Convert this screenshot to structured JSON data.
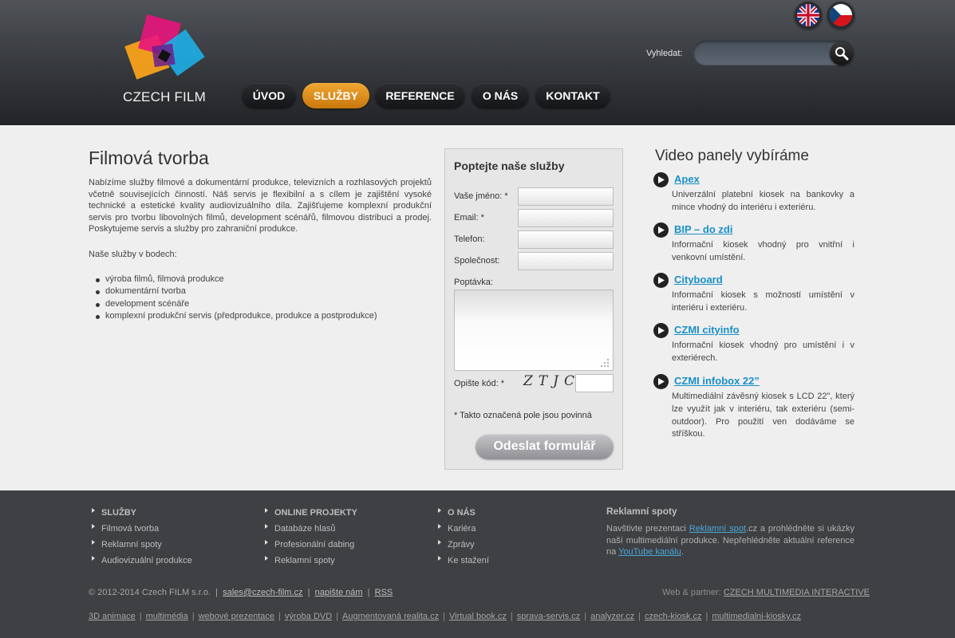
{
  "header": {
    "logo_text": "CZECH FILM",
    "search_label": "Vyhledat:",
    "search_placeholder": "",
    "languages": [
      "en-flag-icon",
      "cz-flag-icon"
    ],
    "nav": [
      {
        "label": "ÚVOD",
        "active": false
      },
      {
        "label": "SLUŽBY",
        "active": true
      },
      {
        "label": "REFERENCE",
        "active": false
      },
      {
        "label": "O NÁS",
        "active": false
      },
      {
        "label": "KONTAKT",
        "active": false
      }
    ]
  },
  "main": {
    "title": "Filmová tvorba",
    "intro": "Nabízíme služby filmové a dokumentární produkce, televizních a rozhlasových projektů včetně souvisejících činností. Náš servis je flexibilní a s cílem je zajištění vysoké technické a estetické kvality audiovizuálního díla. Zajišťujeme komplexní produkční servis pro tvorbu libovolných filmů, development scénářů, filmovou distribuci a prodej. Poskytujeme servis a služby pro zahraniční produkce.",
    "points_title": "Naše služby v bodech:",
    "points": [
      "výroba filmů, filmová produkce",
      "dokumentární tvorba",
      "development scénáře",
      "komplexní produkční servis (předprodukce, produkce a postprodukce)"
    ]
  },
  "form": {
    "title": "Poptejte naše služby",
    "name_label": "Vaše jméno: *",
    "email_label": "Email: *",
    "phone_label": "Telefon:",
    "company_label": "Společnost:",
    "inquiry_label": "Poptávka:",
    "captcha_label": "Opište kód: *",
    "captcha_code": "ZTJC",
    "required_note": "* Takto označená pole jsou povinná",
    "submit_label": "Odeslat formulář"
  },
  "panels": {
    "title": "Video panely vybíráme",
    "items": [
      {
        "name": "Apex",
        "desc": "Univerzální platební kiosek na bankovky a mince vhodný do interiéru i exteriéru."
      },
      {
        "name": "BIP – do zdi",
        "desc": "Informační kiosek vhodný pro vnitřní i venkovní umístění."
      },
      {
        "name": "Cityboard",
        "desc": "Informační kiosek s možností umístění v interiéru i exteriéru."
      },
      {
        "name": "CZMI cityinfo",
        "desc": "Informační kiosek vhodný pro umístění i v exteriérech."
      },
      {
        "name": "CZMI infobox 22”",
        "desc": "Multimediální závěsný kiosek s LCD 22\", který lze využít jak v interiéru, tak exteriéru (semi-outdoor). Pro použití ven dodáváme se stříškou."
      }
    ]
  },
  "footer": {
    "columns": [
      {
        "title": "SLUŽBY",
        "items": [
          "Filmová tvorba",
          "Reklamní spoty",
          "Audiovizuální produkce"
        ]
      },
      {
        "title": "ONLINE PROJEKTY",
        "items": [
          "Databáze hlasů",
          "Profesionální dabing",
          "Reklamní spoty"
        ]
      },
      {
        "title": "O NÁS",
        "items": [
          "Kariéra",
          "Zprávy",
          "Ke stažení"
        ]
      }
    ],
    "rs_title": "Reklamní spoty",
    "rs_text_1": "Navštivte prezentaci ",
    "rs_link_1": "Reklamní spot",
    "rs_text_2": ".cz a prohlédněte si ukázky naší multimediální produkce. Nepřehlédněte aktuální reference na ",
    "rs_link_2": "YouTube kanálu",
    "rs_text_3": ".",
    "copyright": "© 2012-2014   Czech FILM s.r.o.",
    "email": "sales@czech-film.cz",
    "write_us": "napište nám",
    "rss": "RSS",
    "partner_label": "Web & partner: ",
    "partner_link": "CZECH MULTIMEDIA INTERACTIVE",
    "bottom_links": [
      "3D animace",
      "multimédia",
      "webové prezentace",
      "výroba DVD",
      "Augmentovaná realita.cz",
      "Virtual book.cz",
      "sprava-servis.cz",
      "analyzer.cz",
      "czech-kiosk.cz",
      "multimedialni-kiosky.cz"
    ]
  }
}
